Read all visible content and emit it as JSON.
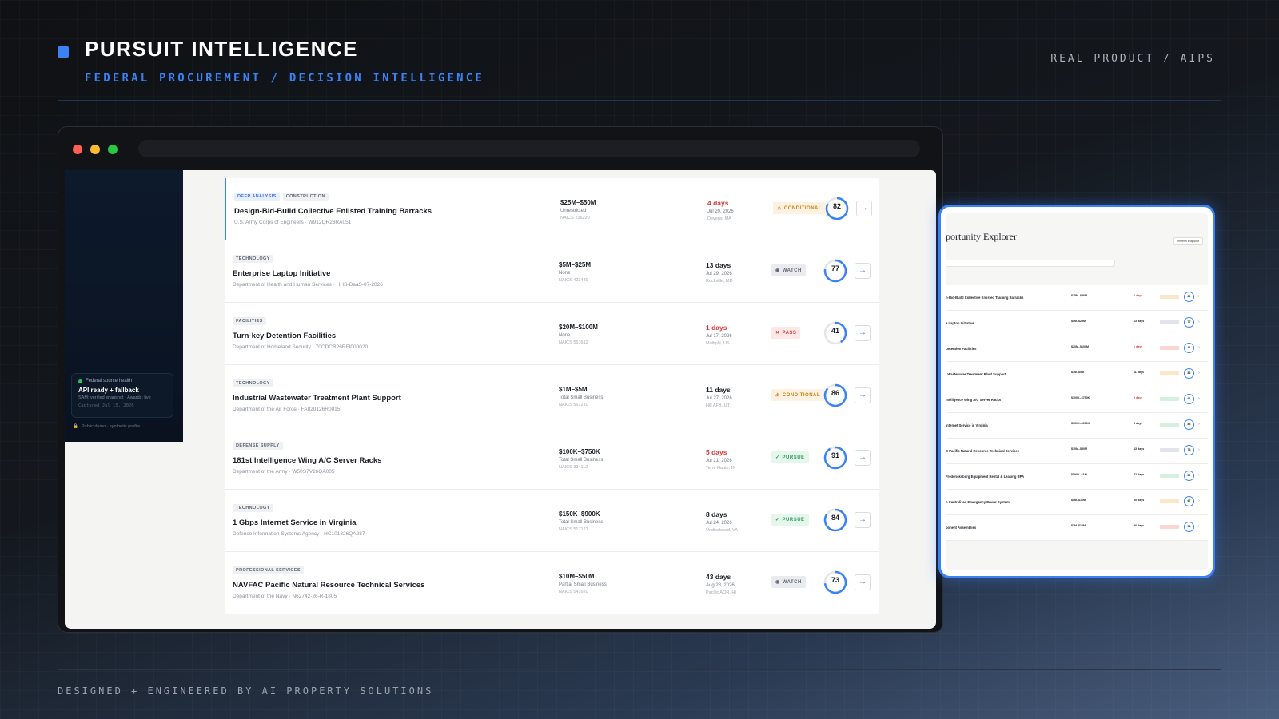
{
  "header": {
    "title": "PURSUIT INTELLIGENCE",
    "subtitle": "FEDERAL PROCUREMENT / DECISION INTELLIGENCE",
    "corner_tag": "REAL PRODUCT / AIPS"
  },
  "footer": {
    "credit": "DESIGNED + ENGINEERED BY AI PROPERTY SOLUTIONS"
  },
  "colors": {
    "accent": "#3b82f6",
    "conditional": "#c7811b",
    "pass": "#d23c3c",
    "pursue": "#2c9c5a",
    "watch": "#5f6876"
  },
  "sidebar": {
    "health_label": "Federal source health",
    "health_status": "API ready + fallback",
    "health_detail": "SAM: verified snapshot · Awards: live",
    "captured": "Captured Jul 15, 2026",
    "demo_note": "Public demo · synthetic profile"
  },
  "opportunities": [
    {
      "tags": [
        "DEEP ANALYSIS",
        "CONSTRUCTION"
      ],
      "name": "Design-Bid-Build Collective Enlisted Training Barracks",
      "agency": "U.S. Army Corps of Engineers · W912QR26RA051",
      "value": "$25M–$50M",
      "setaside": "Unrestricted",
      "naics": "NAICS 236220",
      "due": "4 days",
      "due_urgent": true,
      "date": "Jul 20, 2026",
      "place": "Devens, MA",
      "recommendation": "CONDITIONAL",
      "rec_icon": "warning-icon",
      "score": 82
    },
    {
      "tags": [
        "TECHNOLOGY"
      ],
      "name": "Enterprise Laptop Initiative",
      "agency": "Department of Health and Human Services · HHS-DaaS-07-2026",
      "value": "$5M–$25M",
      "setaside": "None",
      "naics": "NAICS 423430",
      "due": "13 days",
      "due_urgent": false,
      "date": "Jul 29, 2026",
      "place": "Rockville, MD",
      "recommendation": "WATCH",
      "rec_icon": "eye-icon",
      "score": 77
    },
    {
      "tags": [
        "FACILITIES"
      ],
      "name": "Turn-key Detention Facilities",
      "agency": "Department of Homeland Security · 70CDCR26RFI000020",
      "value": "$20M–$100M",
      "setaside": "None",
      "naics": "NAICS 561612",
      "due": "1 days",
      "due_urgent": true,
      "date": "Jul 17, 2026",
      "place": "Multiple, US",
      "recommendation": "PASS",
      "rec_icon": "x-icon",
      "score": 41
    },
    {
      "tags": [
        "TECHNOLOGY"
      ],
      "name": "Industrial Wastewater Treatment Plant Support",
      "agency": "Department of the Air Force · FA820126R0015",
      "value": "$1M–$5M",
      "setaside": "Total Small Business",
      "naics": "NAICS 561210",
      "due": "11 days",
      "due_urgent": false,
      "date": "Jul 27, 2026",
      "place": "Hill AFB, UT",
      "recommendation": "CONDITIONAL",
      "rec_icon": "warning-icon",
      "score": 86
    },
    {
      "tags": [
        "DEFENSE SUPPLY"
      ],
      "name": "181st Intelligence Wing A/C Server Racks",
      "agency": "Department of the Army · W50S7V26QA005",
      "value": "$100K–$750K",
      "setaside": "Total Small Business",
      "naics": "NAICS 334112",
      "due": "5 days",
      "due_urgent": true,
      "date": "Jul 21, 2026",
      "place": "Terre Haute, IN",
      "recommendation": "PURSUE",
      "rec_icon": "check-icon",
      "score": 91
    },
    {
      "tags": [
        "TECHNOLOGY"
      ],
      "name": "1 Gbps Internet Service in Virginia",
      "agency": "Defense Information Systems Agency · HC101326QA287",
      "value": "$150K–$900K",
      "setaside": "Total Small Business",
      "naics": "NAICS 517121",
      "due": "8 days",
      "due_urgent": false,
      "date": "Jul 24, 2026",
      "place": "Undisclosed, VA",
      "recommendation": "PURSUE",
      "rec_icon": "check-icon",
      "score": 84
    },
    {
      "tags": [
        "PROFESSIONAL SERVICES"
      ],
      "name": "NAVFAC Pacific Natural Resource Technical Services",
      "agency": "Department of the Navy · N62742-26-R-1805",
      "value": "$10M–$50M",
      "setaside": "Partial Small Business",
      "naics": "NAICS 541620",
      "due": "43 days",
      "due_urgent": false,
      "date": "Aug 28, 2026",
      "place": "Pacific AOR, HI",
      "recommendation": "WATCH",
      "rec_icon": "eye-icon",
      "score": 73
    }
  ],
  "tablet": {
    "title": "portunity Explorer",
    "snapshot_button": "Refresh snapshot",
    "rows": [
      {
        "name": "n-Bid-Build Collective Enlisted Training Barracks",
        "value": "$25M–$50M",
        "due": "4 days",
        "urgent": true,
        "rec": "conditional",
        "score": "82"
      },
      {
        "name": "e Laptop Initiative",
        "value": "$5M–$25M",
        "due": "13 days",
        "urgent": false,
        "rec": "watch",
        "score": "77"
      },
      {
        "name": "Detention Facilities",
        "value": "$20M–$100M",
        "due": "1 days",
        "urgent": true,
        "rec": "pass",
        "score": "41"
      },
      {
        "name": "l Wastewater Treatment Plant Support",
        "value": "$1M–$5M",
        "due": "11 days",
        "urgent": false,
        "rec": "conditional",
        "score": "86"
      },
      {
        "name": "ntelligence Wing A/C Server Racks",
        "value": "$100K–$750K",
        "due": "5 days",
        "urgent": true,
        "rec": "pursue",
        "score": "91"
      },
      {
        "name": "Internet Service in Virginia",
        "value": "$150K–$900K",
        "due": "8 days",
        "urgent": false,
        "rec": "pursue",
        "score": "84"
      },
      {
        "name": "C Pacific Natural Resource Technical Services",
        "value": "$10M–$50M",
        "due": "43 days",
        "urgent": false,
        "rec": "watch",
        "score": "73"
      },
      {
        "name": "Fredericksburg Equipment Rental & Leasing BPA",
        "value": "$500K–$1M",
        "due": "42 days",
        "urgent": false,
        "rec": "pursue",
        "score": "80"
      },
      {
        "name": "n Centralized Emergency Power System",
        "value": "$5M–$10M",
        "due": "30 days",
        "urgent": false,
        "rec": "conditional",
        "score": "67"
      },
      {
        "name": "ponent Assemblies",
        "value": "$1M–$10M",
        "due": "20 days",
        "urgent": false,
        "rec": "pass",
        "score": "58"
      }
    ]
  }
}
